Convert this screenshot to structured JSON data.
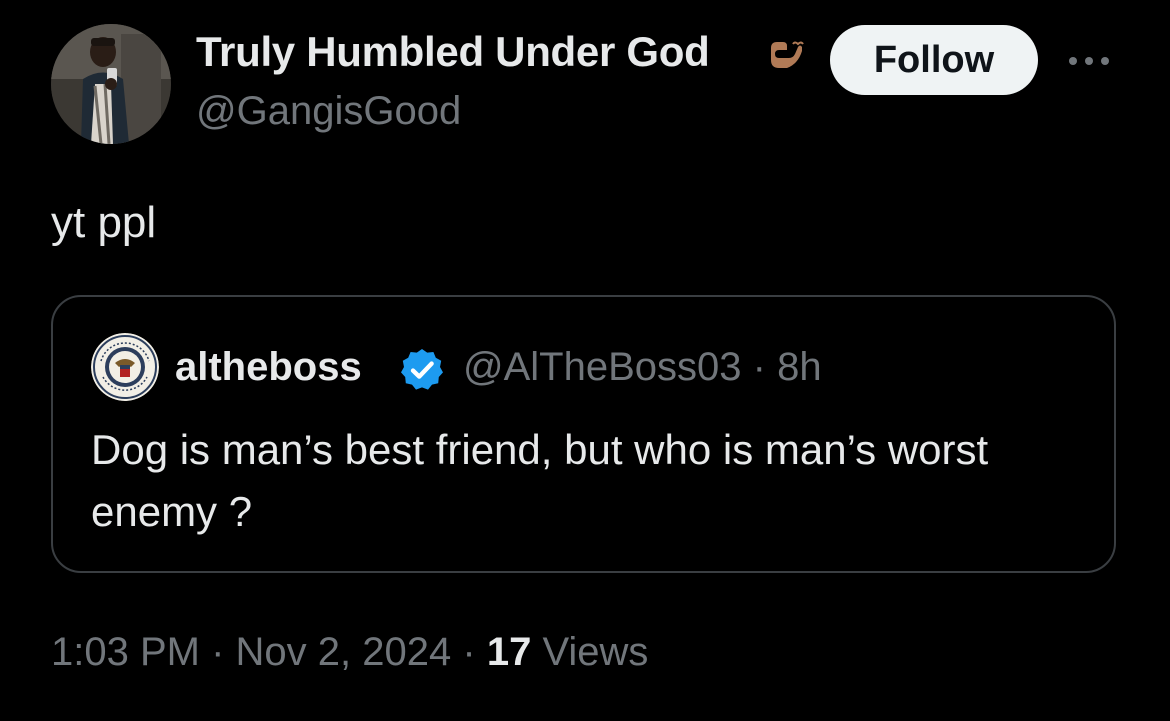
{
  "author": {
    "display_name": "Truly Humbled Under God",
    "handle": "@GangisGood",
    "badge_icon": "hand-heart-icon",
    "badge_color": "#b07a56"
  },
  "follow_label": "Follow",
  "more_icon": "more-horizontal-icon",
  "tweet_text": "yt ppl",
  "quoted_tweet": {
    "display_name": "altheboss",
    "verified_icon": "verified-badge-icon",
    "verified_color": "#1d9bf0",
    "handle": "@AlTheBoss03",
    "separator": "·",
    "age": "8h",
    "text": "Dog is man’s best friend, but who is man’s worst enemy ?"
  },
  "meta": {
    "time": "1:03 PM",
    "separator": "·",
    "date": "Nov 2, 2024",
    "views_count": "17",
    "views_label": "Views"
  },
  "colors": {
    "background": "#000000",
    "primary_text": "#e7e9ea",
    "secondary_text": "#71767b",
    "border": "#3a3e42",
    "follow_bg": "#eff3f4"
  }
}
